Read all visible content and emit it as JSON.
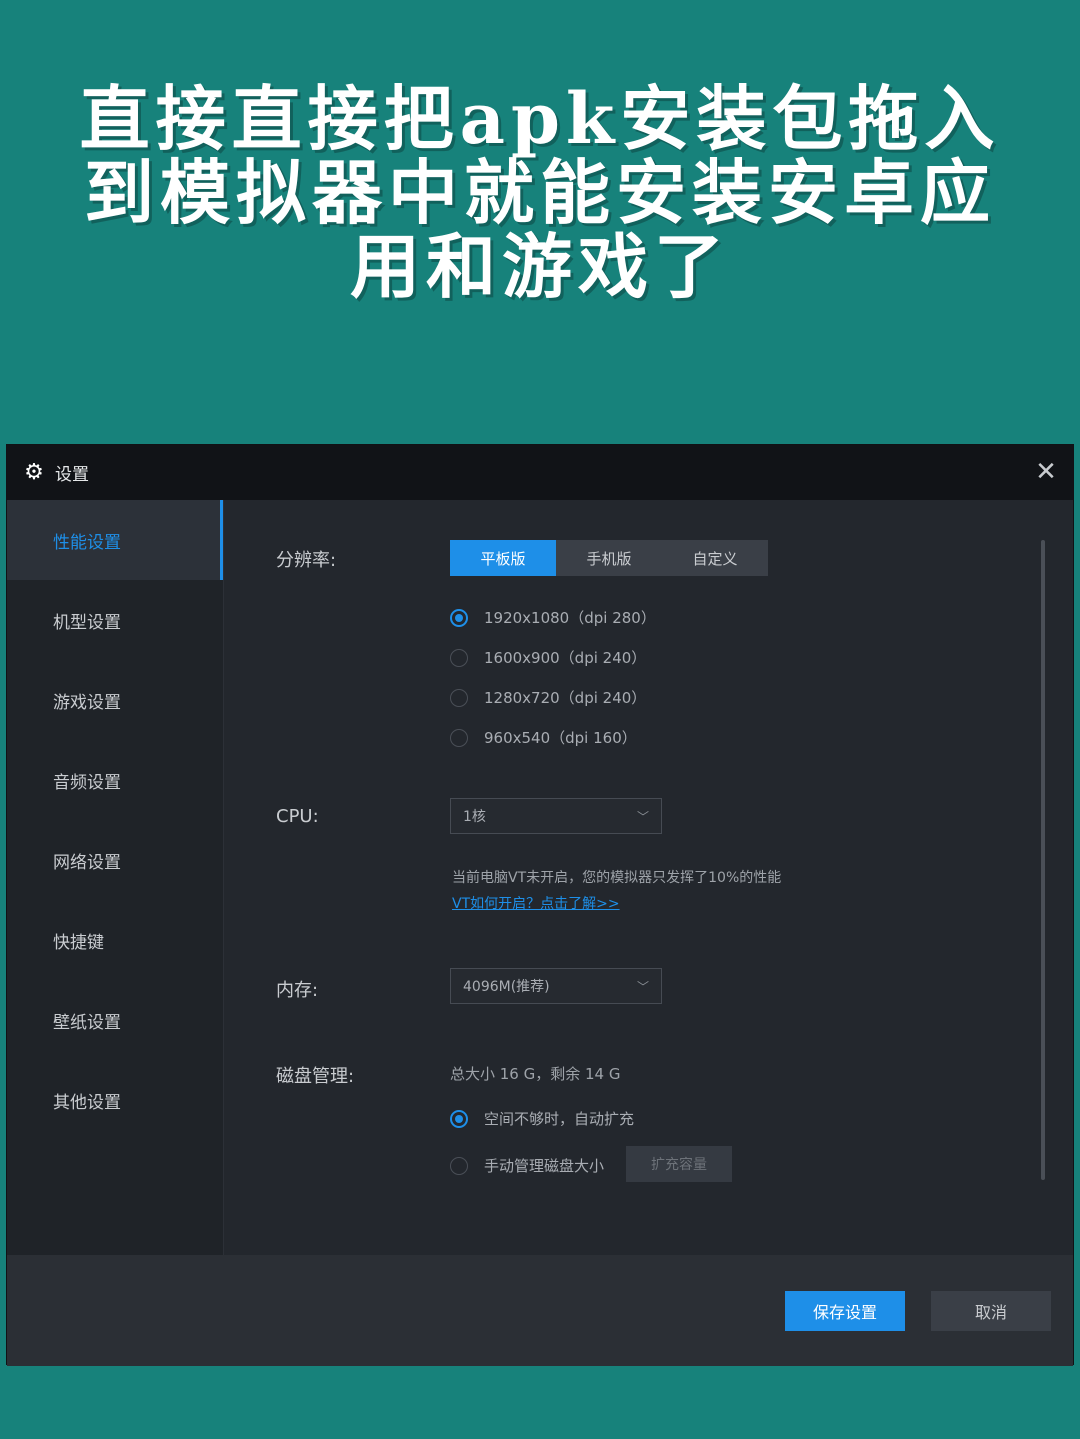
{
  "headline": "直接直接把apk安装包拖入到模拟器中就能安装安卓应用和游戏了",
  "window": {
    "title": "设置"
  },
  "sidebar": {
    "items": [
      {
        "label": "性能设置"
      },
      {
        "label": "机型设置"
      },
      {
        "label": "游戏设置"
      },
      {
        "label": "音频设置"
      },
      {
        "label": "网络设置"
      },
      {
        "label": "快捷键"
      },
      {
        "label": "壁纸设置"
      },
      {
        "label": "其他设置"
      }
    ],
    "active_index": 0
  },
  "resolution": {
    "label": "分辨率:",
    "tabs": [
      {
        "label": "平板版"
      },
      {
        "label": "手机版"
      },
      {
        "label": "自定义"
      }
    ],
    "options": [
      {
        "label": "1920x1080（dpi 280）",
        "selected": true
      },
      {
        "label": "1600x900（dpi 240）",
        "selected": false
      },
      {
        "label": "1280x720（dpi 240）",
        "selected": false
      },
      {
        "label": "960x540（dpi 160）",
        "selected": false
      }
    ]
  },
  "cpu": {
    "label": "CPU:",
    "value": "1核",
    "note": "当前电脑VT未开启，您的模拟器只发挥了10%的性能",
    "link": "VT如何开启？点击了解>>"
  },
  "memory": {
    "label": "内存:",
    "value": "4096M(推荐)"
  },
  "disk": {
    "label": "磁盘管理:",
    "summary": "总大小 16 G，剩余 14 G",
    "option_auto": "空间不够时，自动扩充",
    "option_manual": "手动管理磁盘大小",
    "expand_button": "扩充容量"
  },
  "footer": {
    "save": "保存设置",
    "cancel": "取消"
  },
  "colors": {
    "background": "#17827b",
    "accent": "#1e8fe8",
    "window": "#23272d"
  }
}
